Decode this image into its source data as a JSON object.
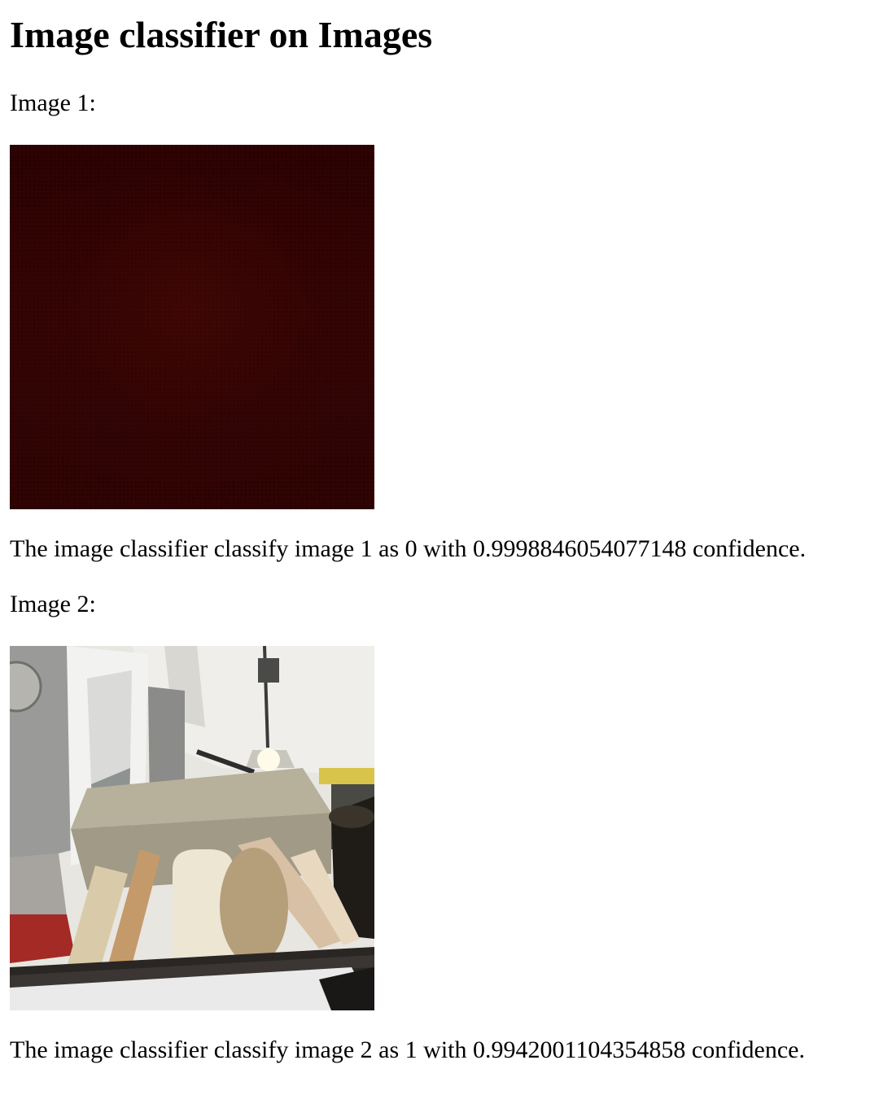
{
  "page": {
    "title": "Image classifier on Images"
  },
  "images": [
    {
      "label": "Image 1:",
      "result": "The image classifier classify image 1 as 0 with 0.9998846054077148 confidence."
    },
    {
      "label": "Image 2:",
      "result": "The image classifier classify image 2 as 1 with 0.9942001104354858 confidence."
    }
  ]
}
